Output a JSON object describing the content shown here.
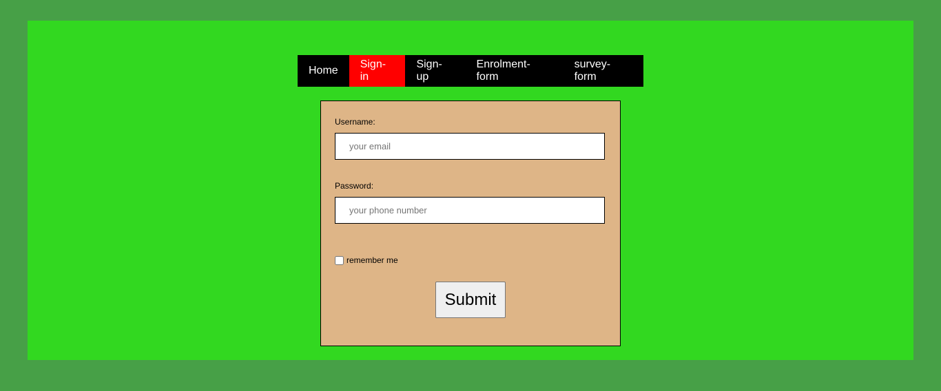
{
  "nav": {
    "items": [
      {
        "label": "Home",
        "active": false
      },
      {
        "label": "Sign-in",
        "active": true
      },
      {
        "label": "Sign-up",
        "active": false
      },
      {
        "label": "Enrolment-form",
        "active": false
      },
      {
        "label": "survey-form",
        "active": false
      }
    ]
  },
  "form": {
    "username_label": "Username:",
    "username_placeholder": "your email",
    "username_value": "",
    "password_label": "Password:",
    "password_placeholder": "your phone number",
    "password_value": "",
    "remember_label": "remember me",
    "remember_checked": false,
    "submit_label": "Submit"
  },
  "colors": {
    "page_bg": "#47a047",
    "panel_bg": "#32d820",
    "nav_bg": "#000000",
    "nav_active": "#ff0000",
    "form_bg": "#deb587"
  }
}
